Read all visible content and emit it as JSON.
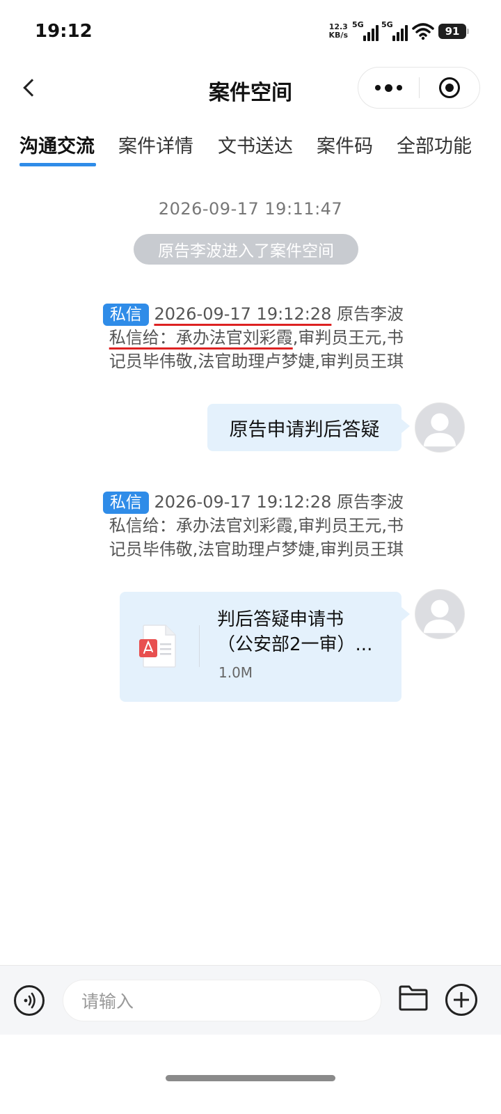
{
  "status_bar": {
    "time": "19:12",
    "net_speed_value": "12.3",
    "net_speed_unit": "KB/s",
    "signal_1_label": "5G",
    "signal_2_label": "5G",
    "battery": "91"
  },
  "header": {
    "title": "案件空间"
  },
  "tabs": [
    {
      "label": "沟通交流",
      "active": true
    },
    {
      "label": "案件详情"
    },
    {
      "label": "文书送达"
    },
    {
      "label": "案件码"
    },
    {
      "label": "全部功能"
    }
  ],
  "chat": {
    "system": {
      "time": "2026-09-17 19:11:47",
      "notice": "原告李波进入了案件空间"
    },
    "messages": [
      {
        "badge": "私信",
        "time": "2026-09-17 19:12:28",
        "sender": "原告李波",
        "recipients_prefix": "私信给：承办法官刘彩霞",
        "recipients_rest": ",审判员王元,书记员毕伟敬,法官助理卢梦婕,审判员王琪",
        "text": "原告申请判后答疑"
      },
      {
        "badge": "私信",
        "time": "2026-09-17 19:12:28",
        "sender": "原告李波",
        "recipients_prefix": "私信给：承办法官刘彩霞",
        "recipients_rest": ",审判员王元,书记员毕伟敬,法官助理卢梦婕,审判员王琪",
        "file": {
          "name_line1": "判后答疑申请书",
          "name_line2": "（公安部2一审）...",
          "size": "1.0M",
          "icon": "pdf-file-icon"
        }
      }
    ]
  },
  "input_bar": {
    "placeholder": "请输入"
  },
  "colors": {
    "accent": "#2f8ce8",
    "bubble": "#e4f1fc",
    "system_pill": "#c8cbd0",
    "annotation_underline": "#dd2222",
    "pdf_red": "#e84f4f"
  }
}
